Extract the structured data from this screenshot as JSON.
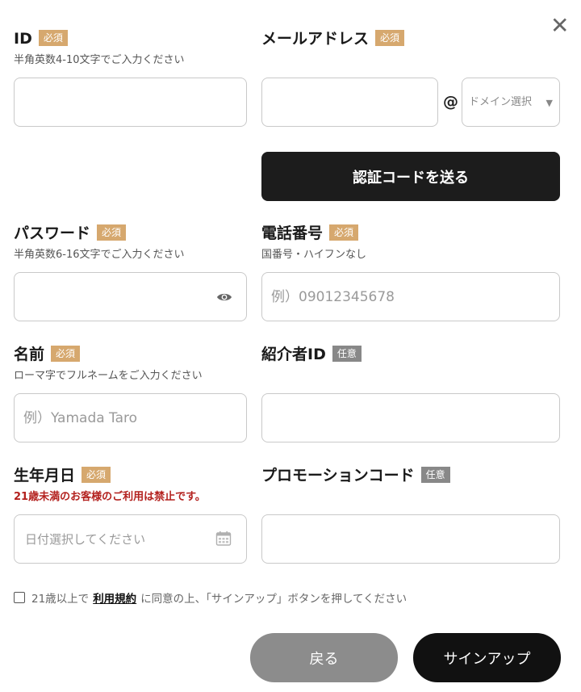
{
  "close": {
    "symbol": "✕"
  },
  "badges": {
    "required": "必須",
    "optional": "任意"
  },
  "id_field": {
    "label": "ID",
    "hint": "半角英数4-10文字でご入力ください",
    "value": "",
    "placeholder": ""
  },
  "email": {
    "label": "メールアドレス",
    "value": "",
    "at": "@",
    "domain_placeholder": "ドメイン選択",
    "domain_arrow": "▼"
  },
  "send_code_button": "認証コードを送る",
  "password": {
    "label": "パスワード",
    "hint": "半角英数6-16文字でご入力ください",
    "value": "",
    "placeholder": ""
  },
  "phone": {
    "label": "電話番号",
    "hint": "国番号・ハイフンなし",
    "placeholder": "例）09012345678"
  },
  "name": {
    "label": "名前",
    "hint": "ローマ字でフルネームをご入力ください",
    "placeholder": "例）Yamada Taro"
  },
  "referrer": {
    "label": "紹介者ID",
    "placeholder": ""
  },
  "birthdate": {
    "label": "生年月日",
    "hint": "21歳未満のお客様のご利用は禁止です。",
    "placeholder": "日付選択してください"
  },
  "promo": {
    "label": "プロモーションコード",
    "placeholder": ""
  },
  "agreement": {
    "prefix": "21歳以上で",
    "link": "利用規約",
    "suffix": "に同意の上、「サインアップ」ボタンを押してください",
    "checked": false
  },
  "buttons": {
    "back": "戻る",
    "signup": "サインアップ"
  },
  "colors": {
    "required_badge": "#d6a86e",
    "optional_badge": "#888888",
    "warning_text": "#b3211e",
    "primary_button": "#1c1c1c",
    "back_button": "#8c8c8c"
  }
}
